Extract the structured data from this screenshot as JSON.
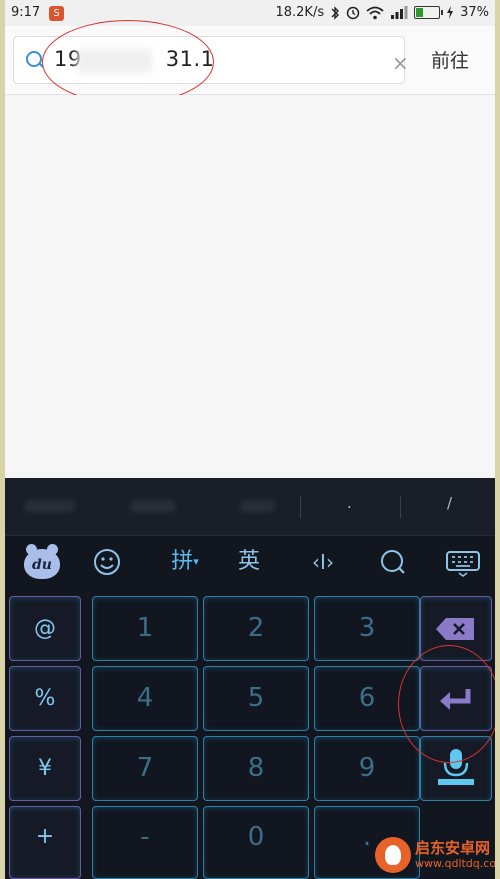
{
  "status": {
    "time": "9:17",
    "app_icon": "S",
    "speed": "18.2K/s",
    "battery": "37%",
    "battery_level": 0.37
  },
  "address": {
    "url_prefix": "19",
    "url_suffix": "31.1",
    "clear_symbol": "×",
    "go_label": "前往"
  },
  "keyboard": {
    "candidates": {
      "dot": ".",
      "slash": "/"
    },
    "toolbar": {
      "logo": "du",
      "pinyin": "拼",
      "english": "英",
      "cursor": "‹I›"
    },
    "side_keys": {
      "at": "@",
      "percent": "%",
      "yen": "¥",
      "plus": "+"
    },
    "digits": [
      "1",
      "2",
      "3",
      "4",
      "5",
      "6",
      "7",
      "8",
      "9",
      "-",
      "0",
      "."
    ]
  },
  "watermark": {
    "title": "启东安卓网",
    "url": "www.qdltdq.com"
  }
}
